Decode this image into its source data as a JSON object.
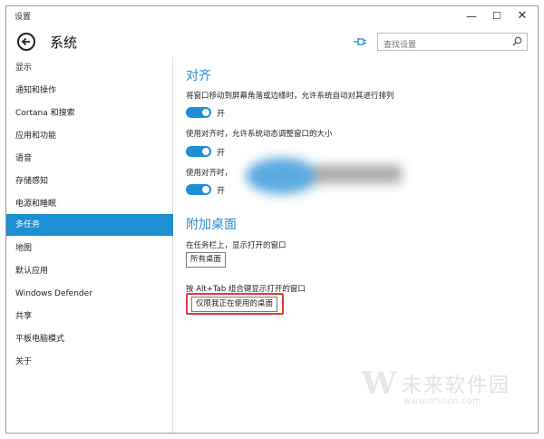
{
  "window": {
    "title": "设置"
  },
  "header": {
    "title": "系统",
    "search_placeholder": "查找设置"
  },
  "sidebar": {
    "items": [
      {
        "label": "显示"
      },
      {
        "label": "通知和操作"
      },
      {
        "label": "Cortana 和搜索"
      },
      {
        "label": "应用和功能"
      },
      {
        "label": "语音"
      },
      {
        "label": "存储感知"
      },
      {
        "label": "电源和睡眠"
      },
      {
        "label": "多任务",
        "active": true
      },
      {
        "label": "地图"
      },
      {
        "label": "默认应用"
      },
      {
        "label": "Windows Defender"
      },
      {
        "label": "共享"
      },
      {
        "label": "平板电脑模式"
      },
      {
        "label": "关于"
      }
    ]
  },
  "snap": {
    "heading": "对齐",
    "options": [
      {
        "label": "将窗口移动到屏幕角落或边缘时，允许系统自动对其进行排列",
        "state": "开"
      },
      {
        "label": "使用对齐时，允许系统动态调整窗口的大小",
        "state": "开"
      },
      {
        "label": "使用对齐时，",
        "state": "开"
      }
    ]
  },
  "desktops": {
    "heading": "附加桌面",
    "taskbar_label": "在任务栏上，显示打开的窗口",
    "taskbar_value": "所有桌面",
    "alttab_label": "按 Alt+Tab 组合键显示打开的窗口",
    "alttab_value": "仅限我正在使用的桌面"
  },
  "watermark": {
    "name": "未来软件园",
    "url": "www.orsoon.com"
  },
  "colors": {
    "accent": "#1e8fd3",
    "heading": "#2a8ad0",
    "highlight": "#e53935"
  }
}
